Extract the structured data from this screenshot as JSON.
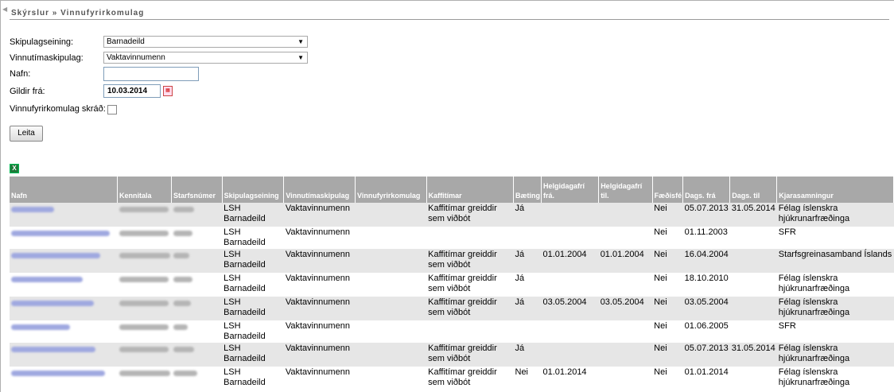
{
  "breadcrumb": "Skýrslur » Vinnufyrirkomulag",
  "form": {
    "skipulagseining_label": "Skipulagseining:",
    "skipulagseining_value": "Barnadeild",
    "vinnutimaskipulag_label": "Vinnutímaskipulag:",
    "vinnutimaskipulag_value": "Vaktavinnumenn",
    "nafn_label": "Nafn:",
    "nafn_value": "",
    "gildir_label": "Gildir frá:",
    "gildir_value": "10.03.2014",
    "skrad_label": "Vinnufyrirkomulag skráð:",
    "skrad_checked": false,
    "search_button": "Leita"
  },
  "table": {
    "headers": [
      "Nafn",
      "Kennitala",
      "Starfsnúmer",
      "Skipulagseining",
      "Vinnutímaskipulag",
      "Vinnufyrirkomulag",
      "Kaffitímar",
      "Bæting",
      "Helgidagafrí frá.",
      "Helgidagafrí til.",
      "Fæðisfé",
      "Dags. frá",
      "Dags. til",
      "Kjarasamningur"
    ],
    "rows": [
      {
        "skipulagseining": "LSH Barnadeild",
        "vinnutimaskipulag": "Vaktavinnumenn",
        "vinnufyrirkomulag": "",
        "kaffitimar": "Kaffitímar greiddir sem viðbót",
        "baeting": "Já",
        "helgi_fra": "",
        "helgi_til": "",
        "faedisfe": "Nei",
        "dags_fra": "05.07.2013",
        "dags_til": "31.05.2014",
        "kjarasamningur": "Félag íslenskra hjúkrunarfræðinga"
      },
      {
        "skipulagseining": "LSH Barnadeild",
        "vinnutimaskipulag": "Vaktavinnumenn",
        "vinnufyrirkomulag": "",
        "kaffitimar": "",
        "baeting": "",
        "helgi_fra": "",
        "helgi_til": "",
        "faedisfe": "Nei",
        "dags_fra": "01.11.2003",
        "dags_til": "",
        "kjarasamningur": "SFR"
      },
      {
        "skipulagseining": "LSH Barnadeild",
        "vinnutimaskipulag": "Vaktavinnumenn",
        "vinnufyrirkomulag": "",
        "kaffitimar": "Kaffitímar greiddir sem viðbót",
        "baeting": "Já",
        "helgi_fra": "01.01.2004",
        "helgi_til": "01.01.2004",
        "faedisfe": "Nei",
        "dags_fra": "16.04.2004",
        "dags_til": "",
        "kjarasamningur": "Starfsgreinasamband Íslands"
      },
      {
        "skipulagseining": "LSH Barnadeild",
        "vinnutimaskipulag": "Vaktavinnumenn",
        "vinnufyrirkomulag": "",
        "kaffitimar": "Kaffitímar greiddir sem viðbót",
        "baeting": "Já",
        "helgi_fra": "",
        "helgi_til": "",
        "faedisfe": "Nei",
        "dags_fra": "18.10.2010",
        "dags_til": "",
        "kjarasamningur": "Félag íslenskra hjúkrunarfræðinga"
      },
      {
        "skipulagseining": "LSH Barnadeild",
        "vinnutimaskipulag": "Vaktavinnumenn",
        "vinnufyrirkomulag": "",
        "kaffitimar": "Kaffitímar greiddir sem viðbót",
        "baeting": "Já",
        "helgi_fra": "03.05.2004",
        "helgi_til": "03.05.2004",
        "faedisfe": "Nei",
        "dags_fra": "03.05.2004",
        "dags_til": "",
        "kjarasamningur": "Félag íslenskra hjúkrunarfræðinga"
      },
      {
        "skipulagseining": "LSH Barnadeild",
        "vinnutimaskipulag": "Vaktavinnumenn",
        "vinnufyrirkomulag": "",
        "kaffitimar": "",
        "baeting": "",
        "helgi_fra": "",
        "helgi_til": "",
        "faedisfe": "Nei",
        "dags_fra": "01.06.2005",
        "dags_til": "",
        "kjarasamningur": "SFR"
      },
      {
        "skipulagseining": "LSH Barnadeild",
        "vinnutimaskipulag": "Vaktavinnumenn",
        "vinnufyrirkomulag": "",
        "kaffitimar": "Kaffitímar greiddir sem viðbót",
        "baeting": "Já",
        "helgi_fra": "",
        "helgi_til": "",
        "faedisfe": "Nei",
        "dags_fra": "05.07.2013",
        "dags_til": "31.05.2014",
        "kjarasamningur": "Félag íslenskra hjúkrunarfræðinga"
      },
      {
        "skipulagseining": "LSH Barnadeild",
        "vinnutimaskipulag": "Vaktavinnumenn",
        "vinnufyrirkomulag": "",
        "kaffitimar": "Kaffitímar greiddir sem viðbót",
        "baeting": "Nei",
        "helgi_fra": "01.01.2014",
        "helgi_til": "",
        "faedisfe": "Nei",
        "dags_fra": "01.01.2014",
        "dags_til": "",
        "kjarasamningur": "Félag íslenskra hjúkrunarfræðinga"
      }
    ]
  }
}
